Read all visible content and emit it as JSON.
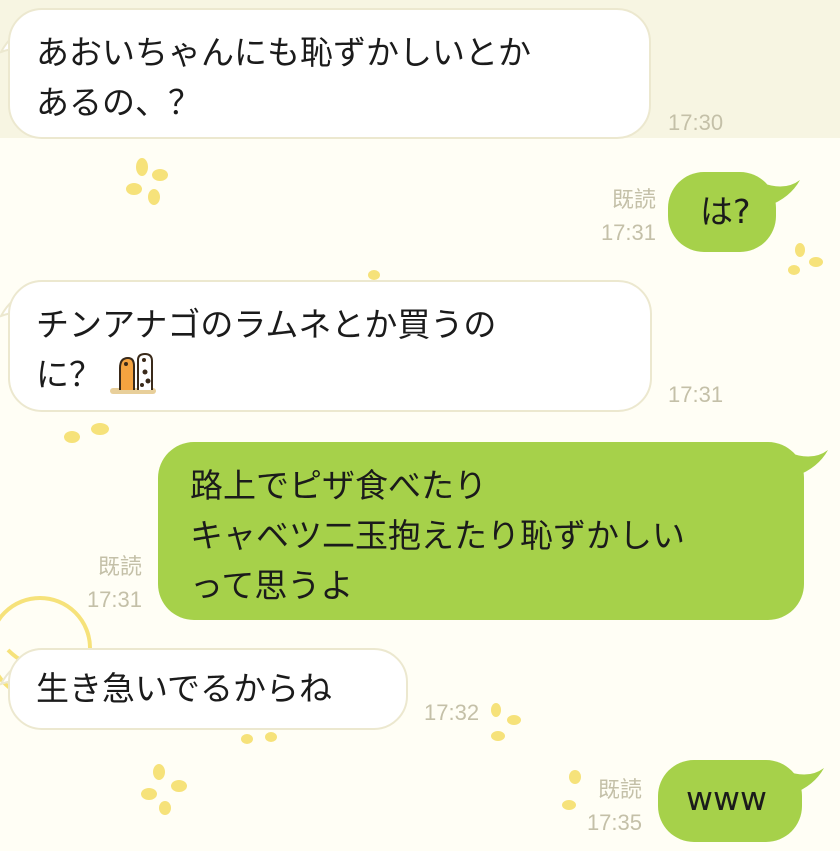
{
  "messages": [
    {
      "direction": "incoming",
      "lines": [
        "あおいちゃんにも恥ずかしいとか",
        "あるの、？"
      ],
      "time": "17:30"
    },
    {
      "direction": "outgoing",
      "lines": [
        "は?"
      ],
      "read": "既読",
      "time": "17:31"
    },
    {
      "direction": "incoming",
      "lines": [
        "チンアナゴのラムネとか買うの",
        "に？"
      ],
      "sticker": "garden-eel-emoji",
      "time": "17:31"
    },
    {
      "direction": "outgoing",
      "lines": [
        "路上でピザ食べたり",
        "キャベツ二玉抱えたり恥ずかしい",
        "って思うよ"
      ],
      "read": "既読",
      "time": "17:31"
    },
    {
      "direction": "incoming",
      "lines": [
        "生き急いでるからね"
      ],
      "time": "17:32"
    },
    {
      "direction": "outgoing",
      "lines": [
        "www"
      ],
      "read": "既読",
      "time": "17:35"
    }
  ],
  "colors": {
    "background": "#fffef5",
    "incoming_bubble": "#ffffff",
    "outgoing_bubble": "#a6d14a",
    "meta_text": "#c4c0a8",
    "decoration": "#f6e27a"
  },
  "decorations": [
    "flower-sparkle-icon",
    "mascot-face-icon"
  ]
}
